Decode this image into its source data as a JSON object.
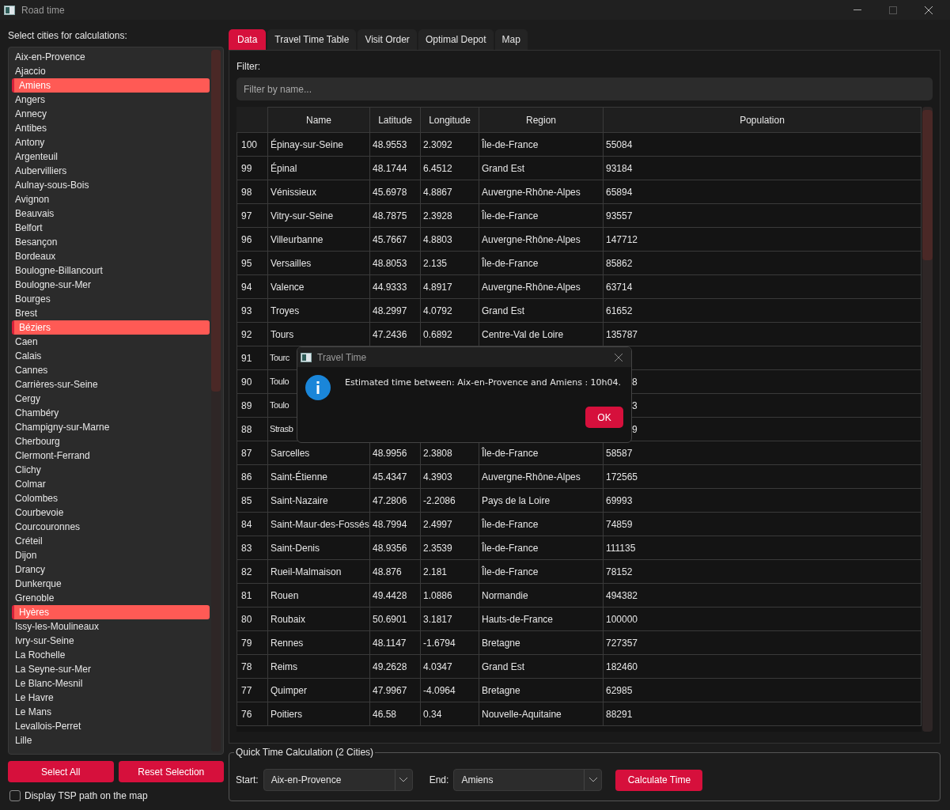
{
  "window": {
    "title": "Road time"
  },
  "cities": {
    "label": "Select cities for calculations:",
    "items": [
      {
        "name": "Aix-en-Provence",
        "selected": false
      },
      {
        "name": "Ajaccio",
        "selected": false
      },
      {
        "name": "Amiens",
        "selected": true
      },
      {
        "name": "Angers",
        "selected": false
      },
      {
        "name": "Annecy",
        "selected": false
      },
      {
        "name": "Antibes",
        "selected": false
      },
      {
        "name": "Antony",
        "selected": false
      },
      {
        "name": "Argenteuil",
        "selected": false
      },
      {
        "name": "Aubervilliers",
        "selected": false
      },
      {
        "name": "Aulnay-sous-Bois",
        "selected": false
      },
      {
        "name": "Avignon",
        "selected": false
      },
      {
        "name": "Beauvais",
        "selected": false
      },
      {
        "name": "Belfort",
        "selected": false
      },
      {
        "name": "Besançon",
        "selected": false
      },
      {
        "name": "Bordeaux",
        "selected": false
      },
      {
        "name": "Boulogne-Billancourt",
        "selected": false
      },
      {
        "name": "Boulogne-sur-Mer",
        "selected": false
      },
      {
        "name": "Bourges",
        "selected": false
      },
      {
        "name": "Brest",
        "selected": false
      },
      {
        "name": "Béziers",
        "selected": true
      },
      {
        "name": "Caen",
        "selected": false
      },
      {
        "name": "Calais",
        "selected": false
      },
      {
        "name": "Cannes",
        "selected": false
      },
      {
        "name": "Carrières-sur-Seine",
        "selected": false
      },
      {
        "name": "Cergy",
        "selected": false
      },
      {
        "name": "Chambéry",
        "selected": false
      },
      {
        "name": "Champigny-sur-Marne",
        "selected": false
      },
      {
        "name": "Cherbourg",
        "selected": false
      },
      {
        "name": "Clermont-Ferrand",
        "selected": false
      },
      {
        "name": "Clichy",
        "selected": false
      },
      {
        "name": "Colmar",
        "selected": false
      },
      {
        "name": "Colombes",
        "selected": false
      },
      {
        "name": "Courbevoie",
        "selected": false
      },
      {
        "name": "Courcouronnes",
        "selected": false
      },
      {
        "name": "Créteil",
        "selected": false
      },
      {
        "name": "Dijon",
        "selected": false
      },
      {
        "name": "Drancy",
        "selected": false
      },
      {
        "name": "Dunkerque",
        "selected": false
      },
      {
        "name": "Grenoble",
        "selected": false
      },
      {
        "name": "Hyères",
        "selected": true
      },
      {
        "name": "Issy-les-Moulineaux",
        "selected": false
      },
      {
        "name": "Ivry-sur-Seine",
        "selected": false
      },
      {
        "name": "La Rochelle",
        "selected": false
      },
      {
        "name": "La Seyne-sur-Mer",
        "selected": false
      },
      {
        "name": "Le Blanc-Mesnil",
        "selected": false
      },
      {
        "name": "Le Havre",
        "selected": false
      },
      {
        "name": "Le Mans",
        "selected": false
      },
      {
        "name": "Levallois-Perret",
        "selected": false
      },
      {
        "name": "Lille",
        "selected": false
      }
    ]
  },
  "buttons": [
    "Select All",
    "Reset Selection"
  ],
  "tsp_checkbox": {
    "label": "Display TSP path on the map",
    "checked": false
  },
  "tabs": [
    {
      "label": "Data",
      "selected": true
    },
    {
      "label": "Travel Time Table",
      "selected": false
    },
    {
      "label": "Visit Order",
      "selected": false
    },
    {
      "label": "Optimal Depot",
      "selected": false
    },
    {
      "label": "Map",
      "selected": false
    }
  ],
  "filter": {
    "label": "Filter:",
    "placeholder": "Filter by name..."
  },
  "table": {
    "columns": [
      "Name",
      "Latitude",
      "Longitude",
      "Region",
      "Population"
    ],
    "rows": [
      {
        "index": "100",
        "cells": [
          "Épinay-sur-Seine",
          "48.9553",
          "2.3092",
          "Île-de-France",
          "55084"
        ]
      },
      {
        "index": "99",
        "cells": [
          "Épinal",
          "48.1744",
          "6.4512",
          "Grand Est",
          "93184"
        ]
      },
      {
        "index": "98",
        "cells": [
          "Vénissieux",
          "45.6978",
          "4.8867",
          "Auvergne-Rhône-Alpes",
          "65894"
        ]
      },
      {
        "index": "97",
        "cells": [
          "Vitry-sur-Seine",
          "48.7875",
          "2.3928",
          "Île-de-France",
          "93557"
        ]
      },
      {
        "index": "96",
        "cells": [
          "Villeurbanne",
          "45.7667",
          "4.8803",
          "Auvergne-Rhône-Alpes",
          "147712"
        ]
      },
      {
        "index": "95",
        "cells": [
          "Versailles",
          "48.8053",
          "2.135",
          "Île-de-France",
          "85862"
        ]
      },
      {
        "index": "94",
        "cells": [
          "Valence",
          "44.9333",
          "4.8917",
          "Auvergne-Rhône-Alpes",
          "63714"
        ]
      },
      {
        "index": "93",
        "cells": [
          "Troyes",
          "48.2997",
          "4.0792",
          "Grand Est",
          "61652"
        ]
      },
      {
        "index": "92",
        "cells": [
          "Tours",
          "47.2436",
          "0.6892",
          "Centre-Val de Loire",
          "135787"
        ]
      },
      {
        "index": "91",
        "kind": "covered",
        "cells": [
          "Tourc"
        ]
      },
      {
        "index": "90",
        "kind": "covered",
        "cells": [
          "Toulo",
          "8"
        ]
      },
      {
        "index": "89",
        "kind": "covered",
        "cells": [
          "Toulo",
          "3"
        ]
      },
      {
        "index": "88",
        "kind": "covered",
        "cells": [
          "Strasb",
          "9"
        ]
      },
      {
        "index": "87",
        "cells": [
          "Sarcelles",
          "48.9956",
          "2.3808",
          "Île-de-France",
          "58587"
        ]
      },
      {
        "index": "86",
        "cells": [
          "Saint-Étienne",
          "45.4347",
          "4.3903",
          "Auvergne-Rhône-Alpes",
          "172565"
        ]
      },
      {
        "index": "85",
        "cells": [
          "Saint-Nazaire",
          "47.2806",
          "-2.2086",
          "Pays de la Loire",
          "69993"
        ]
      },
      {
        "index": "84",
        "cells": [
          "Saint-Maur-des-Fossés",
          "48.7994",
          "2.4997",
          "Île-de-France",
          "74859"
        ]
      },
      {
        "index": "83",
        "cells": [
          "Saint-Denis",
          "48.9356",
          "2.3539",
          "Île-de-France",
          "111135"
        ]
      },
      {
        "index": "82",
        "cells": [
          "Rueil-Malmaison",
          "48.876",
          "2.181",
          "Île-de-France",
          "78152"
        ]
      },
      {
        "index": "81",
        "cells": [
          "Rouen",
          "49.4428",
          "1.0886",
          "Normandie",
          "494382"
        ]
      },
      {
        "index": "80",
        "cells": [
          "Roubaix",
          "50.6901",
          "3.1817",
          "Hauts-de-France",
          "100000"
        ]
      },
      {
        "index": "79",
        "cells": [
          "Rennes",
          "48.1147",
          "-1.6794",
          "Bretagne",
          "727357"
        ]
      },
      {
        "index": "78",
        "cells": [
          "Reims",
          "49.2628",
          "4.0347",
          "Grand Est",
          "182460"
        ]
      },
      {
        "index": "77",
        "cells": [
          "Quimper",
          "47.9967",
          "-4.0964",
          "Bretagne",
          "62985"
        ]
      },
      {
        "index": "76",
        "cells": [
          "Poitiers",
          "46.58",
          "0.34",
          "Nouvelle-Aquitaine",
          "88291"
        ]
      }
    ]
  },
  "quick_calc": {
    "title": "Quick Time Calculation (2 Cities)",
    "start_label": "Start:",
    "start": "Aix-en-Provence",
    "end_label": "End:",
    "end": "Amiens",
    "button": "Calculate Time"
  },
  "dialog": {
    "title": "Travel Time",
    "message": "Estimated time between: Aix-en-Provence and Amiens : 10h04.",
    "button": "OK"
  }
}
